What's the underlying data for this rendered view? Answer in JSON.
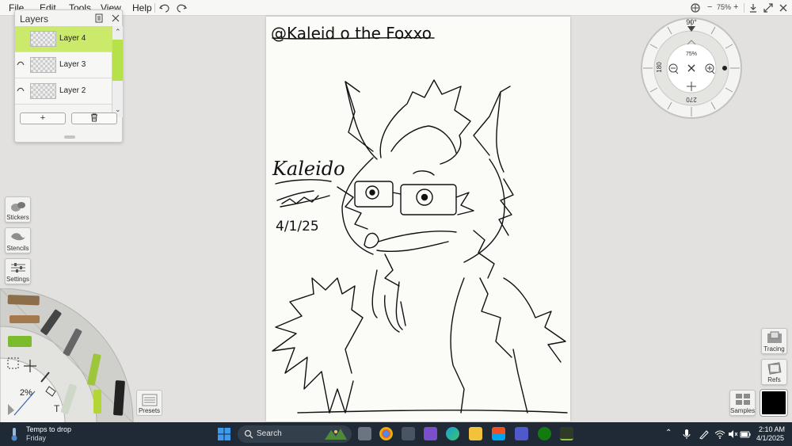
{
  "menu": {
    "items": [
      "File",
      "Edit",
      "Tools",
      "View",
      "Help"
    ]
  },
  "toolbar": {
    "zoom_readout": "75%",
    "zoom_minus": "−",
    "zoom_plus": "+"
  },
  "layers": {
    "title": "Layers",
    "items": [
      {
        "label": "Layer 4",
        "selected": true
      },
      {
        "label": "Layer 3",
        "selected": false
      },
      {
        "label": "Layer 2",
        "selected": false
      }
    ],
    "add_label": "+",
    "accent": "#b6e14a"
  },
  "side_tools": {
    "stickers": "Stickers",
    "stencils": "Stencils",
    "settings": "Settings"
  },
  "wheel": {
    "opacity": "2%",
    "presets": "Presets",
    "text_tool": "T"
  },
  "canvas": {
    "handle": "@Kaleid o the Foxxo",
    "name": "Kaleido",
    "date": "4/1/25"
  },
  "dial": {
    "angle": "90°",
    "zoom": "75%",
    "left_label": "180",
    "bottom_label": "270"
  },
  "right_tools": {
    "tracing": "Tracing",
    "refs": "Refs",
    "samples": "Samples"
  },
  "colors": {
    "current_color": "#000000"
  },
  "taskbar": {
    "weather_title": "Temps to drop",
    "weather_sub": "Friday",
    "search_label": "Search",
    "time": "2:10 AM",
    "date": "4/1/2025"
  }
}
